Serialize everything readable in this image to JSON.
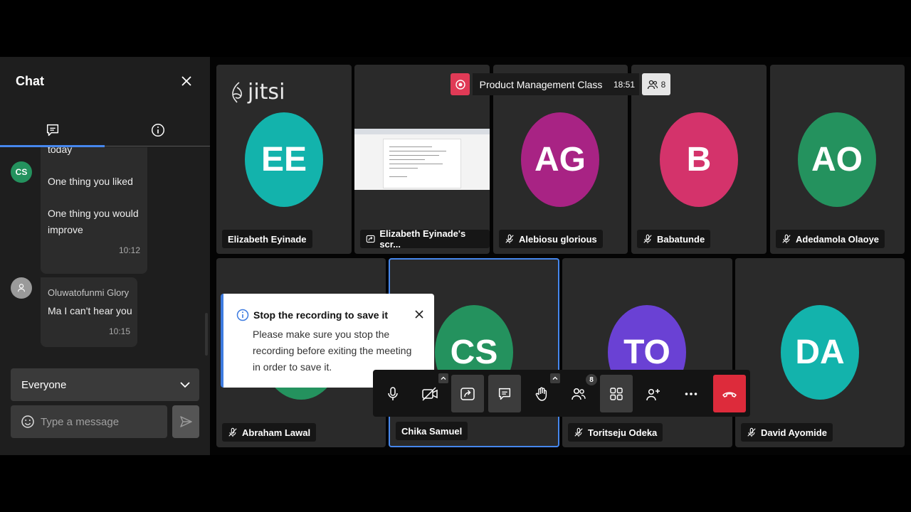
{
  "chat": {
    "title": "Chat",
    "messages": [
      {
        "avatar": "CS",
        "sender": "",
        "lines": [
          "today",
          "One thing you liked",
          "One thing you would improve"
        ],
        "time": "10:12"
      },
      {
        "avatar": "",
        "sender": "Oluwatofunmi Glory",
        "lines": [
          "Ma I can't hear you"
        ],
        "time": "10:15"
      }
    ],
    "recipient": "Everyone",
    "input_placeholder": "Type a message"
  },
  "meeting": {
    "title": "Product Management Class",
    "time": "18:51",
    "participant_count": "8",
    "logo_text": "jitsi"
  },
  "tiles": [
    {
      "initials": "EE",
      "name": "Elizabeth Eyinade",
      "color": "#13b3ac"
    },
    {
      "initials": "",
      "name": "Elizabeth Eyinade's scr...",
      "color": ""
    },
    {
      "initials": "AG",
      "name": "Alebiosu glorious",
      "color": "#a82384"
    },
    {
      "initials": "B",
      "name": "Babatunde",
      "color": "#d4336b"
    },
    {
      "initials": "AO",
      "name": "Adedamola Olaoye",
      "color": "#24925e"
    },
    {
      "initials": "",
      "name": "Abraham Lawal",
      "color": "#24925e"
    },
    {
      "initials": "CS",
      "name": "Chika Samuel",
      "color": "#24925e"
    },
    {
      "initials": "TO",
      "name": "Toritseju Odeka",
      "color": "#6a41d4"
    },
    {
      "initials": "DA",
      "name": "David Ayomide",
      "color": "#13b3ac"
    }
  ],
  "notification": {
    "title": "Stop the recording to save it",
    "body": "Please make sure you stop the recording before exiting the meeting in order to save it."
  },
  "toolbar": {
    "participants_badge": "8"
  },
  "colors": {
    "accent": "#4687ed",
    "record": "#e03a56",
    "hangup": "#dd2b3b"
  }
}
